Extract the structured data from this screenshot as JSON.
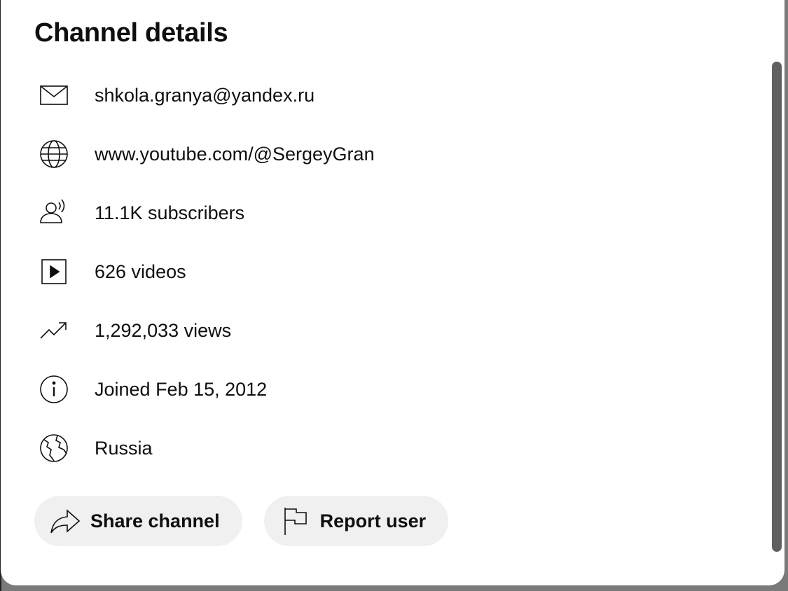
{
  "dialog": {
    "title": "Channel details"
  },
  "details": [
    {
      "icon": "mail-icon",
      "text": "shkola.granya@yandex.ru"
    },
    {
      "icon": "globe-icon",
      "text": "www.youtube.com/@SergeyGran"
    },
    {
      "icon": "subscribers-icon",
      "text": "11.1K subscribers"
    },
    {
      "icon": "video-play-icon",
      "text": "626 videos"
    },
    {
      "icon": "trending-icon",
      "text": "1,292,033 views"
    },
    {
      "icon": "info-icon",
      "text": "Joined Feb 15, 2012"
    },
    {
      "icon": "globe-country-icon",
      "text": "Russia"
    }
  ],
  "actions": {
    "share": {
      "icon": "share-icon",
      "label": "Share channel"
    },
    "report": {
      "icon": "flag-icon",
      "label": "Report user"
    }
  },
  "colors": {
    "text": "#0f0f0f",
    "pill_bg": "#f0f0f0",
    "scrollbar": "#606060"
  }
}
